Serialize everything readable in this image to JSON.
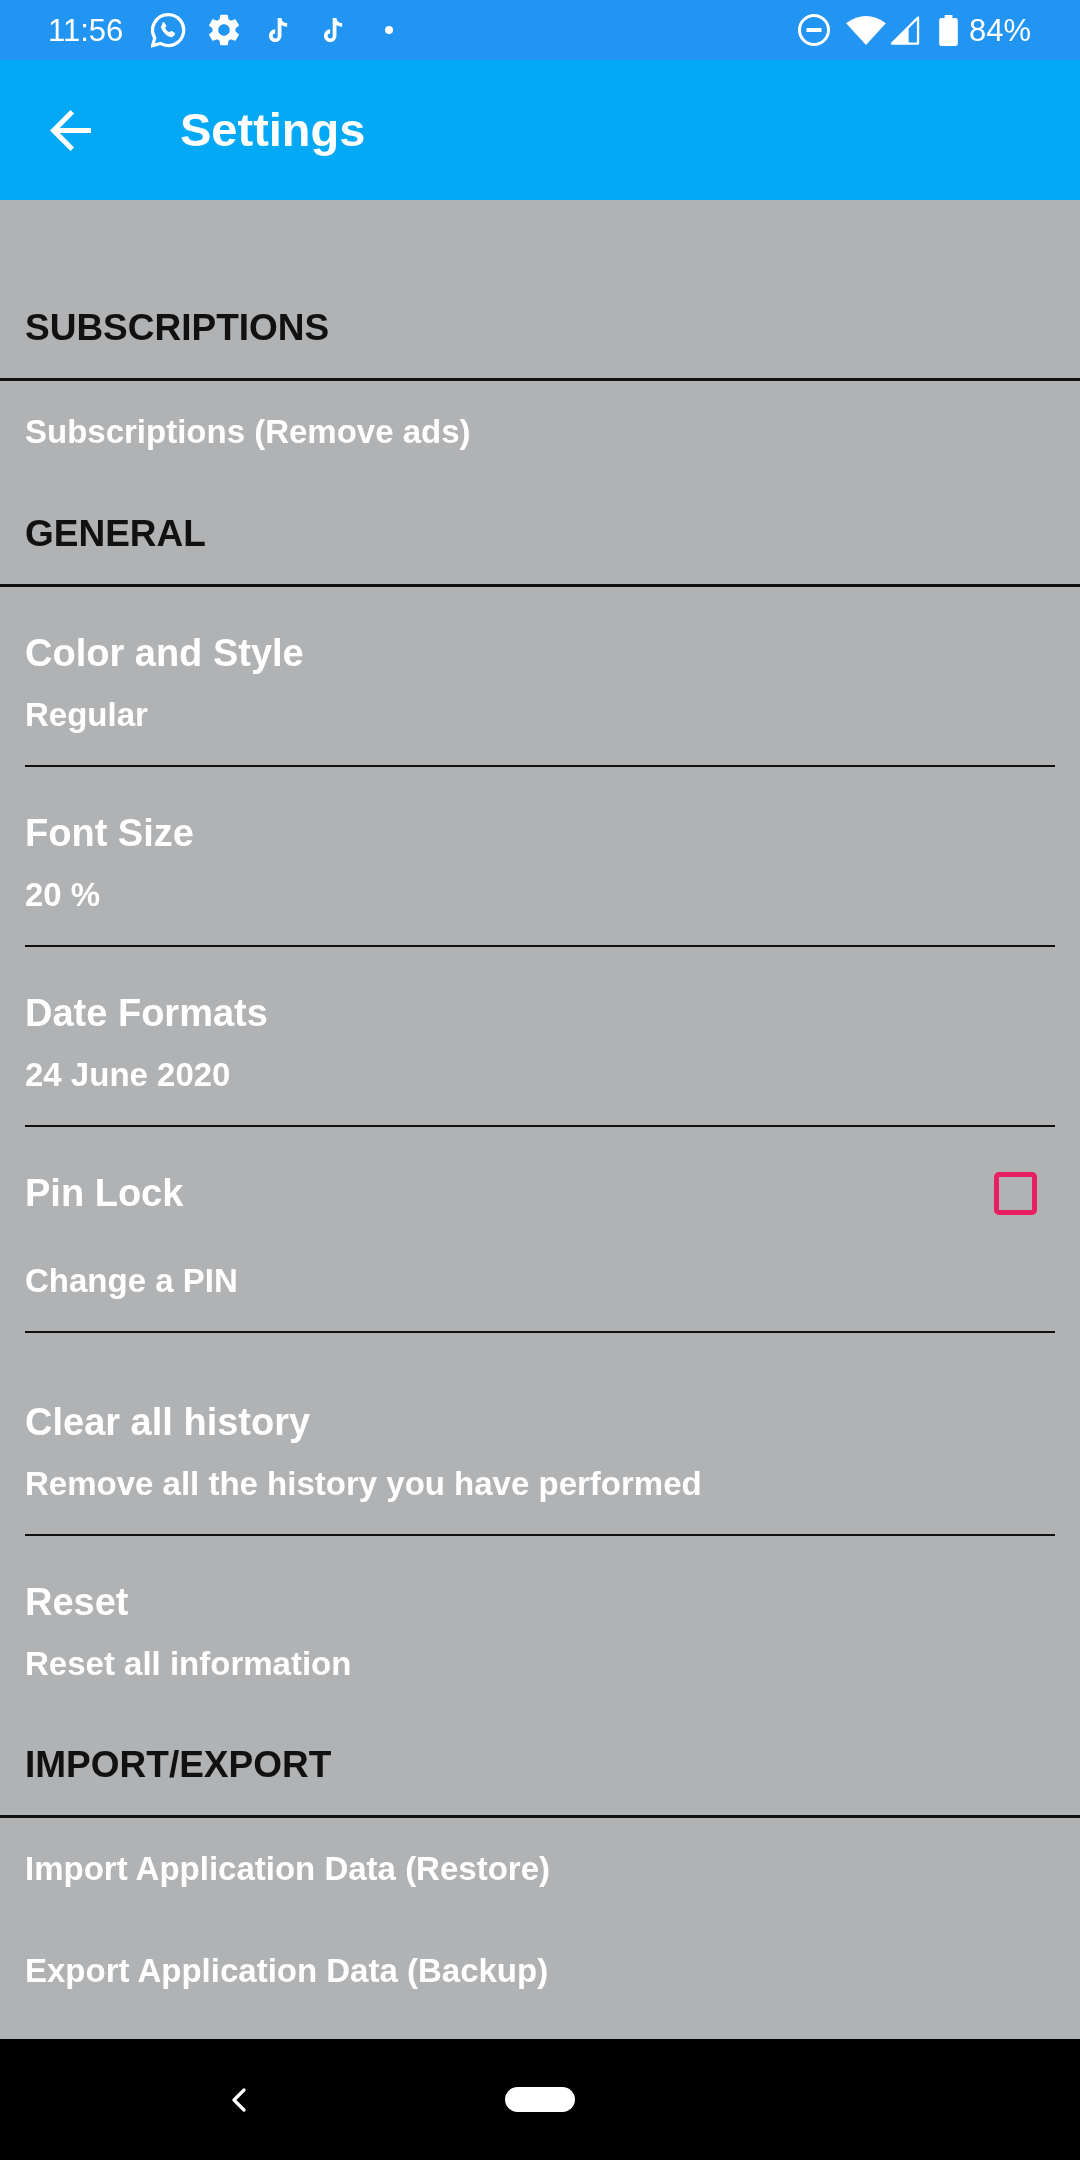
{
  "status_bar": {
    "time": "11:56",
    "battery": "84%"
  },
  "toolbar": {
    "title": "Settings"
  },
  "sections": [
    {
      "header": "SUBSCRIPTIONS",
      "items": [
        {
          "kind": "link",
          "title": "Subscriptions (Remove ads)"
        }
      ]
    },
    {
      "header": "GENERAL",
      "items": [
        {
          "kind": "preference",
          "title": "Color and Style",
          "summary": "Regular"
        },
        {
          "kind": "preference",
          "title": "Font Size",
          "summary": "20 %"
        },
        {
          "kind": "preference",
          "title": "Date Formats",
          "summary": "24 June 2020"
        },
        {
          "kind": "checkbox",
          "title": "Pin Lock",
          "summary": "Change a PIN",
          "checked": false
        },
        {
          "kind": "preference",
          "title": "Clear all history",
          "summary": "Remove all the history you have performed"
        },
        {
          "kind": "preference",
          "title": "Reset",
          "summary": "Reset all information"
        }
      ]
    },
    {
      "header": "IMPORT/EXPORT",
      "items": [
        {
          "kind": "link",
          "title": "Import Application Data (Restore)"
        },
        {
          "kind": "link",
          "title": "Export Application Data (Backup)"
        }
      ]
    }
  ]
}
